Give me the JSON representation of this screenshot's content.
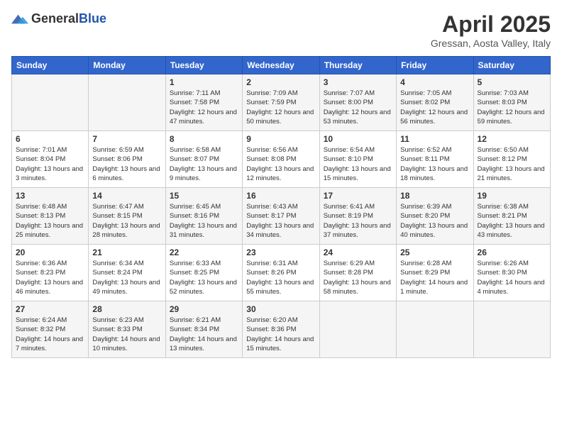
{
  "header": {
    "logo_general": "General",
    "logo_blue": "Blue",
    "month": "April 2025",
    "location": "Gressan, Aosta Valley, Italy"
  },
  "weekdays": [
    "Sunday",
    "Monday",
    "Tuesday",
    "Wednesday",
    "Thursday",
    "Friday",
    "Saturday"
  ],
  "weeks": [
    [
      {
        "day": "",
        "sunrise": "",
        "sunset": "",
        "daylight": ""
      },
      {
        "day": "",
        "sunrise": "",
        "sunset": "",
        "daylight": ""
      },
      {
        "day": "1",
        "sunrise": "Sunrise: 7:11 AM",
        "sunset": "Sunset: 7:58 PM",
        "daylight": "Daylight: 12 hours and 47 minutes."
      },
      {
        "day": "2",
        "sunrise": "Sunrise: 7:09 AM",
        "sunset": "Sunset: 7:59 PM",
        "daylight": "Daylight: 12 hours and 50 minutes."
      },
      {
        "day": "3",
        "sunrise": "Sunrise: 7:07 AM",
        "sunset": "Sunset: 8:00 PM",
        "daylight": "Daylight: 12 hours and 53 minutes."
      },
      {
        "day": "4",
        "sunrise": "Sunrise: 7:05 AM",
        "sunset": "Sunset: 8:02 PM",
        "daylight": "Daylight: 12 hours and 56 minutes."
      },
      {
        "day": "5",
        "sunrise": "Sunrise: 7:03 AM",
        "sunset": "Sunset: 8:03 PM",
        "daylight": "Daylight: 12 hours and 59 minutes."
      }
    ],
    [
      {
        "day": "6",
        "sunrise": "Sunrise: 7:01 AM",
        "sunset": "Sunset: 8:04 PM",
        "daylight": "Daylight: 13 hours and 3 minutes."
      },
      {
        "day": "7",
        "sunrise": "Sunrise: 6:59 AM",
        "sunset": "Sunset: 8:06 PM",
        "daylight": "Daylight: 13 hours and 6 minutes."
      },
      {
        "day": "8",
        "sunrise": "Sunrise: 6:58 AM",
        "sunset": "Sunset: 8:07 PM",
        "daylight": "Daylight: 13 hours and 9 minutes."
      },
      {
        "day": "9",
        "sunrise": "Sunrise: 6:56 AM",
        "sunset": "Sunset: 8:08 PM",
        "daylight": "Daylight: 13 hours and 12 minutes."
      },
      {
        "day": "10",
        "sunrise": "Sunrise: 6:54 AM",
        "sunset": "Sunset: 8:10 PM",
        "daylight": "Daylight: 13 hours and 15 minutes."
      },
      {
        "day": "11",
        "sunrise": "Sunrise: 6:52 AM",
        "sunset": "Sunset: 8:11 PM",
        "daylight": "Daylight: 13 hours and 18 minutes."
      },
      {
        "day": "12",
        "sunrise": "Sunrise: 6:50 AM",
        "sunset": "Sunset: 8:12 PM",
        "daylight": "Daylight: 13 hours and 21 minutes."
      }
    ],
    [
      {
        "day": "13",
        "sunrise": "Sunrise: 6:48 AM",
        "sunset": "Sunset: 8:13 PM",
        "daylight": "Daylight: 13 hours and 25 minutes."
      },
      {
        "day": "14",
        "sunrise": "Sunrise: 6:47 AM",
        "sunset": "Sunset: 8:15 PM",
        "daylight": "Daylight: 13 hours and 28 minutes."
      },
      {
        "day": "15",
        "sunrise": "Sunrise: 6:45 AM",
        "sunset": "Sunset: 8:16 PM",
        "daylight": "Daylight: 13 hours and 31 minutes."
      },
      {
        "day": "16",
        "sunrise": "Sunrise: 6:43 AM",
        "sunset": "Sunset: 8:17 PM",
        "daylight": "Daylight: 13 hours and 34 minutes."
      },
      {
        "day": "17",
        "sunrise": "Sunrise: 6:41 AM",
        "sunset": "Sunset: 8:19 PM",
        "daylight": "Daylight: 13 hours and 37 minutes."
      },
      {
        "day": "18",
        "sunrise": "Sunrise: 6:39 AM",
        "sunset": "Sunset: 8:20 PM",
        "daylight": "Daylight: 13 hours and 40 minutes."
      },
      {
        "day": "19",
        "sunrise": "Sunrise: 6:38 AM",
        "sunset": "Sunset: 8:21 PM",
        "daylight": "Daylight: 13 hours and 43 minutes."
      }
    ],
    [
      {
        "day": "20",
        "sunrise": "Sunrise: 6:36 AM",
        "sunset": "Sunset: 8:23 PM",
        "daylight": "Daylight: 13 hours and 46 minutes."
      },
      {
        "day": "21",
        "sunrise": "Sunrise: 6:34 AM",
        "sunset": "Sunset: 8:24 PM",
        "daylight": "Daylight: 13 hours and 49 minutes."
      },
      {
        "day": "22",
        "sunrise": "Sunrise: 6:33 AM",
        "sunset": "Sunset: 8:25 PM",
        "daylight": "Daylight: 13 hours and 52 minutes."
      },
      {
        "day": "23",
        "sunrise": "Sunrise: 6:31 AM",
        "sunset": "Sunset: 8:26 PM",
        "daylight": "Daylight: 13 hours and 55 minutes."
      },
      {
        "day": "24",
        "sunrise": "Sunrise: 6:29 AM",
        "sunset": "Sunset: 8:28 PM",
        "daylight": "Daylight: 13 hours and 58 minutes."
      },
      {
        "day": "25",
        "sunrise": "Sunrise: 6:28 AM",
        "sunset": "Sunset: 8:29 PM",
        "daylight": "Daylight: 14 hours and 1 minute."
      },
      {
        "day": "26",
        "sunrise": "Sunrise: 6:26 AM",
        "sunset": "Sunset: 8:30 PM",
        "daylight": "Daylight: 14 hours and 4 minutes."
      }
    ],
    [
      {
        "day": "27",
        "sunrise": "Sunrise: 6:24 AM",
        "sunset": "Sunset: 8:32 PM",
        "daylight": "Daylight: 14 hours and 7 minutes."
      },
      {
        "day": "28",
        "sunrise": "Sunrise: 6:23 AM",
        "sunset": "Sunset: 8:33 PM",
        "daylight": "Daylight: 14 hours and 10 minutes."
      },
      {
        "day": "29",
        "sunrise": "Sunrise: 6:21 AM",
        "sunset": "Sunset: 8:34 PM",
        "daylight": "Daylight: 14 hours and 13 minutes."
      },
      {
        "day": "30",
        "sunrise": "Sunrise: 6:20 AM",
        "sunset": "Sunset: 8:36 PM",
        "daylight": "Daylight: 14 hours and 15 minutes."
      },
      {
        "day": "",
        "sunrise": "",
        "sunset": "",
        "daylight": ""
      },
      {
        "day": "",
        "sunrise": "",
        "sunset": "",
        "daylight": ""
      },
      {
        "day": "",
        "sunrise": "",
        "sunset": "",
        "daylight": ""
      }
    ]
  ]
}
